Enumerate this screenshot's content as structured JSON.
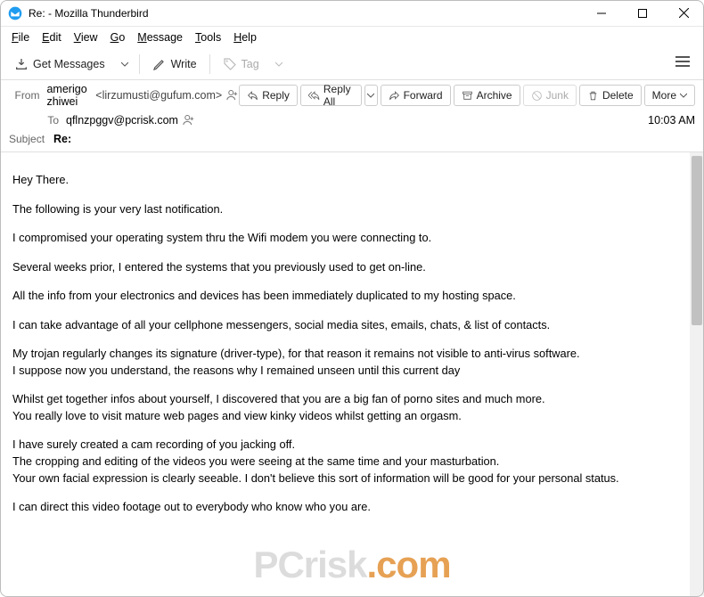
{
  "titlebar": {
    "title": "Re: - Mozilla Thunderbird"
  },
  "menu": {
    "file": "File",
    "edit": "Edit",
    "view": "View",
    "go": "Go",
    "message": "Message",
    "tools": "Tools",
    "help": "Help"
  },
  "toolbar": {
    "get": "Get Messages",
    "write": "Write",
    "tag": "Tag"
  },
  "header": {
    "from_lbl": "From",
    "from_name": "amerigo zhiwei",
    "from_addr": "<lirzumusti@gufum.com>",
    "to_lbl": "To",
    "to_addr": "qflnzpggv@pcrisk.com",
    "time": "10:03 AM",
    "subject_lbl": "Subject",
    "subject": "Re:"
  },
  "actions": {
    "reply": "Reply",
    "reply_all": "Reply All",
    "forward": "Forward",
    "archive": "Archive",
    "junk": "Junk",
    "delete": "Delete",
    "more": "More"
  },
  "body": {
    "p1": "Hey There.",
    "p2": "The following is your very last notification.",
    "p3": "I compromised your operating system thru the Wifi modem you were connecting to.",
    "p4": "Several weeks prior, I entered the systems that you previously used to get on-line.",
    "p5": "All the info from your electronics and devices has been immediately duplicated to my hosting space.",
    "p6": "I can take advantage of all your cellphone messengers, social media sites, emails, chats, & list of contacts.",
    "p7": "My trojan regularly changes its signature (driver-type), for that reason it remains not visible to anti-virus software.\nI suppose now you understand, the reasons why I remained unseen until this current day",
    "p8": "Whilst get together infos about yourself, I discovered that you are a big fan of porno sites and much more.\nYou really love to visit mature web pages and view kinky videos whilst getting an orgasm.",
    "p9": "I have surely created a cam recording of you jacking off.\nThe cropping and editing of the videos you were seeing at the same time and your masturbation.\nYour own facial expression is clearly seeable. I don't believe this sort of information will be good for your personal status.",
    "p10": "I can direct this video footage out to everybody who know who you are."
  },
  "watermark": {
    "brand": "PCrisk",
    "tld": ".com"
  }
}
